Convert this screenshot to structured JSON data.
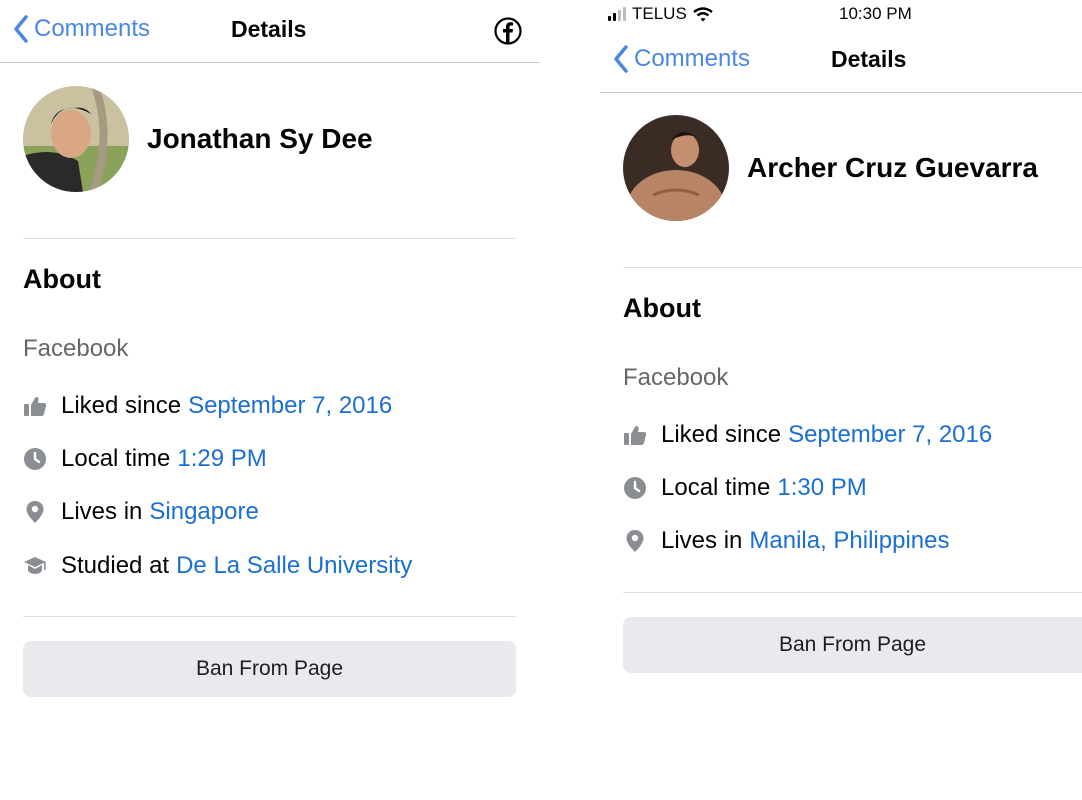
{
  "left_screen": {
    "nav": {
      "back_label": "Comments",
      "title": "Details",
      "right_icon": "facebook-logo-icon"
    },
    "profile": {
      "name": "Jonathan Sy Dee"
    },
    "about_heading": "About",
    "source_label": "Facebook",
    "rows": [
      {
        "icon": "thumbs-up-icon",
        "label": "Liked since",
        "value": "September 7, 2016"
      },
      {
        "icon": "clock-icon",
        "label": "Local time",
        "value": "1:29 PM"
      },
      {
        "icon": "location-pin-icon",
        "label": "Lives in",
        "value": "Singapore"
      },
      {
        "icon": "graduation-cap-icon",
        "label": "Studied at",
        "value": "De La Salle University"
      }
    ],
    "ban_button": "Ban From Page"
  },
  "right_screen": {
    "status_bar": {
      "carrier": "TELUS",
      "time": "10:30 PM",
      "signal_bars": "2 of 4"
    },
    "nav": {
      "back_label": "Comments",
      "title": "Details"
    },
    "profile": {
      "name": "Archer Cruz Guevarra"
    },
    "about_heading": "About",
    "source_label": "Facebook",
    "rows": [
      {
        "icon": "thumbs-up-icon",
        "label": "Liked since",
        "value": "September 7, 2016"
      },
      {
        "icon": "clock-icon",
        "label": "Local time",
        "value": "1:30 PM"
      },
      {
        "icon": "location-pin-icon",
        "label": "Lives in",
        "value": "Manila, Philippines"
      }
    ],
    "ban_button": "Ban From Page"
  },
  "colors": {
    "link": "#1b6fd0",
    "back": "#4a86e8",
    "icon": "#8a8d91",
    "button_bg": "#e8eaed"
  }
}
